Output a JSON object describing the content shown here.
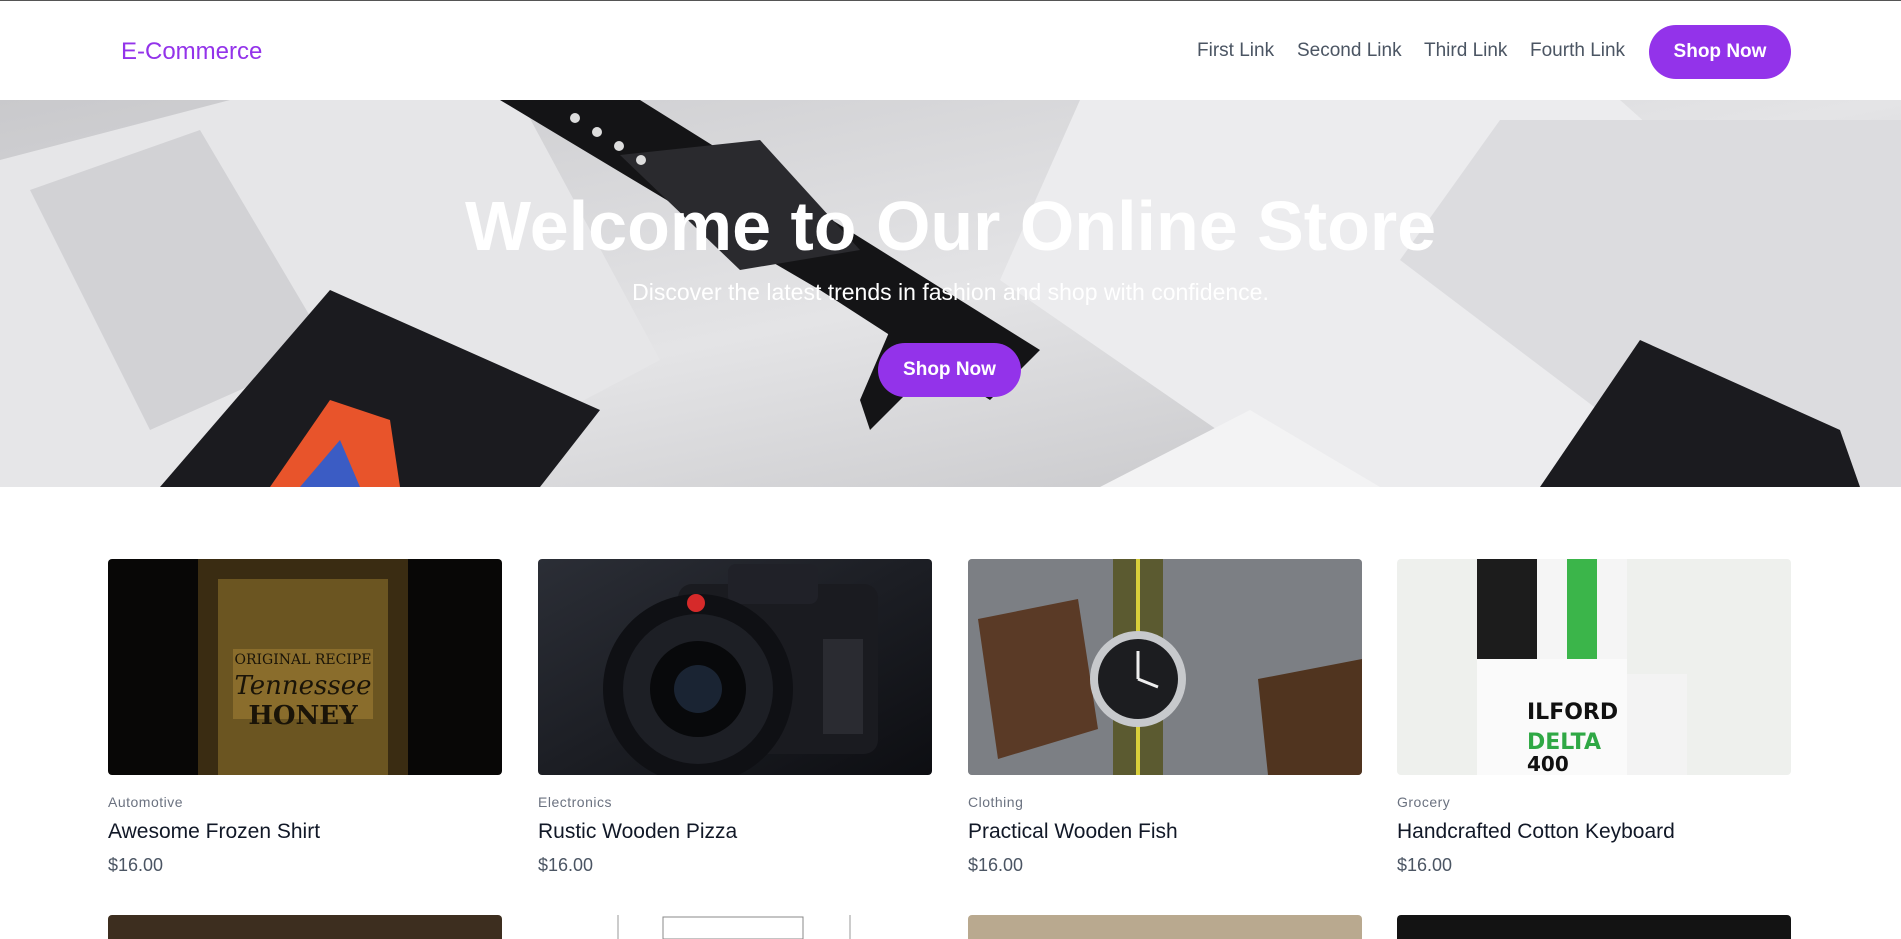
{
  "header": {
    "brand": "E-Commerce",
    "links": [
      "First Link",
      "Second Link",
      "Third Link",
      "Fourth Link"
    ],
    "cta_label": "Shop Now"
  },
  "hero": {
    "title": "Welcome to Our Online Store",
    "subtitle": "Discover the latest trends in fashion and shop with confidence.",
    "cta_label": "Shop Now"
  },
  "products": [
    {
      "category": "Automotive",
      "name": "Awesome Frozen Shirt",
      "price": "$16.00"
    },
    {
      "category": "Electronics",
      "name": "Rustic Wooden Pizza",
      "price": "$16.00"
    },
    {
      "category": "Clothing",
      "name": "Practical Wooden Fish",
      "price": "$16.00"
    },
    {
      "category": "Grocery",
      "name": "Handcrafted Cotton Keyboard",
      "price": "$16.00"
    }
  ],
  "colors": {
    "accent": "#9333ea",
    "text": "#111827",
    "muted": "#6b7280"
  }
}
